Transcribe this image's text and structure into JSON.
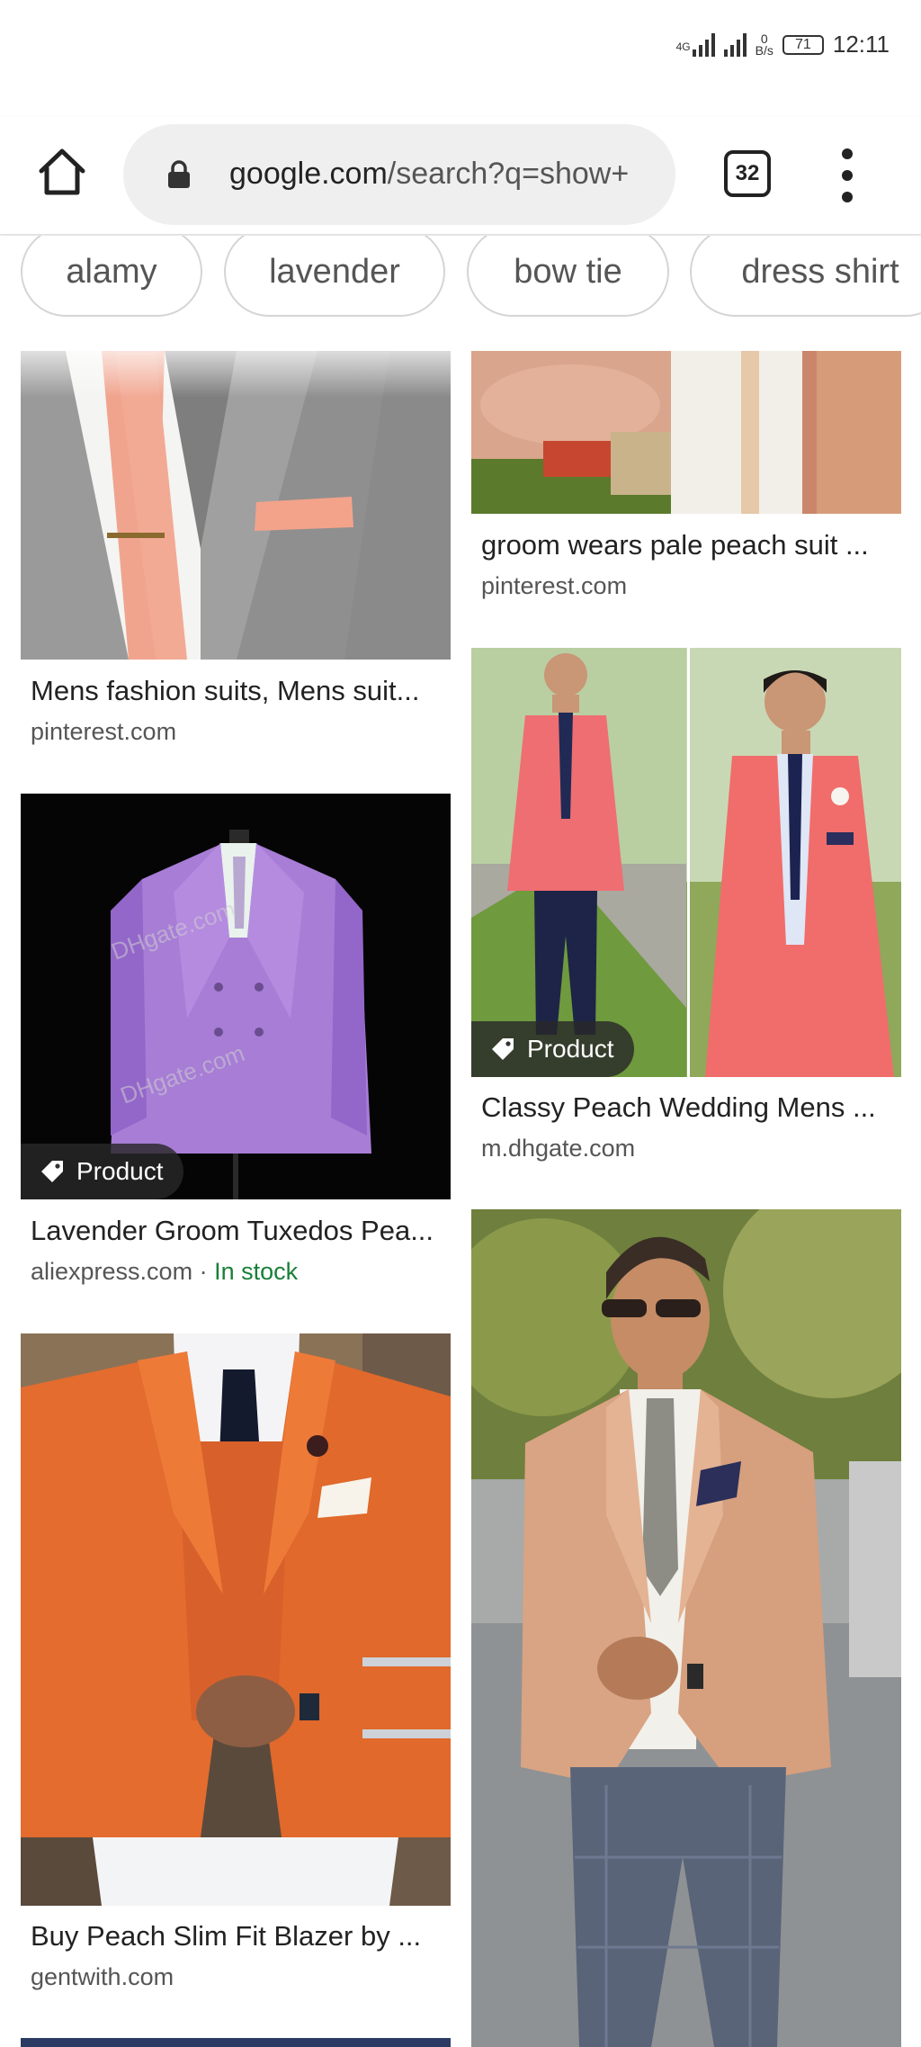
{
  "status_bar": {
    "network": "4G",
    "speed_value": "0",
    "speed_unit": "B/s",
    "battery": "71",
    "time": "12:11"
  },
  "browser": {
    "url_main": "google.com",
    "url_rest": "/search?q=show+",
    "tab_count": "32"
  },
  "chips": [
    {
      "label": "alamy"
    },
    {
      "label": "lavender"
    },
    {
      "label": "bow tie"
    },
    {
      "label": "dress shirt"
    }
  ],
  "results": [
    {
      "title": "Mens fashion suits, Mens suit...",
      "source": "pinterest.com"
    },
    {
      "title": "groom wears pale peach suit ...",
      "source": "pinterest.com"
    },
    {
      "title": "Lavender Groom Tuxedos Pea...",
      "source": "aliexpress.com",
      "separator": " · ",
      "stock": "In stock",
      "badge": "Product"
    },
    {
      "title": "Classy Peach Wedding Mens ...",
      "source": "m.dhgate.com",
      "badge": "Product"
    },
    {
      "title": "Buy Peach Slim Fit Blazer by ...",
      "source": "gentwith.com"
    }
  ],
  "image_texts": {
    "watermark_1": "DHgate.com",
    "watermark_2": "DHgate.com"
  },
  "colors": {
    "in_stock": "#188038",
    "chip_border": "#d5d5d5",
    "url_pill": "#efefef"
  },
  "icons": [
    "home-icon",
    "lock-icon",
    "tab-switcher-icon",
    "more-options-icon",
    "price-tag-icon"
  ]
}
